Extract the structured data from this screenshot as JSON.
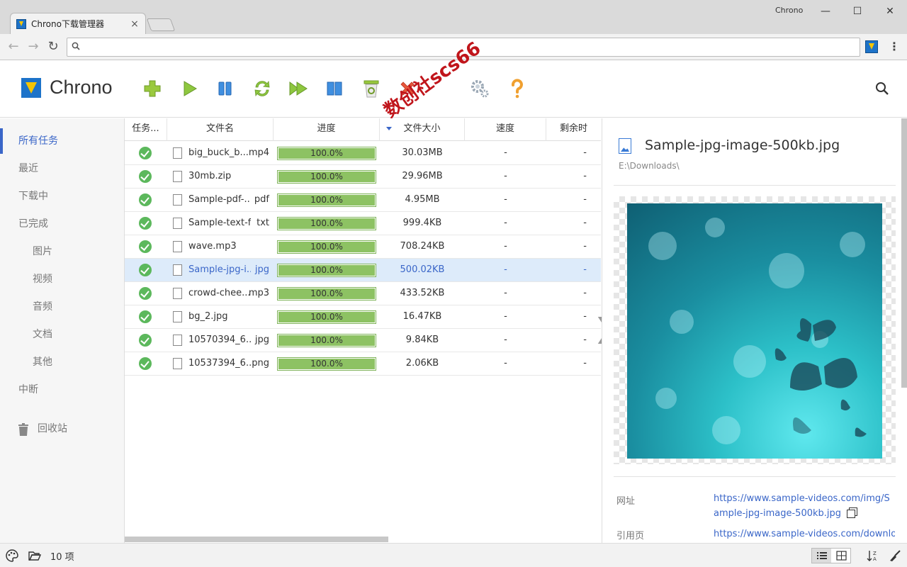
{
  "browser": {
    "tab_title": "Chrono下载管理器",
    "tab_close": "×",
    "user_name": "Chrono",
    "win_min": "—",
    "win_max": "☐",
    "win_close": "✕",
    "back": "←",
    "forward": "→",
    "reload": "↻",
    "menu": "⋮",
    "omnibox_value": ""
  },
  "app": {
    "name": "Chrono",
    "watermark": "数创社scs66"
  },
  "sidebar": {
    "items": [
      {
        "label": "所有任务"
      },
      {
        "label": "最近"
      },
      {
        "label": "下载中"
      },
      {
        "label": "已完成"
      },
      {
        "label": "图片"
      },
      {
        "label": "视频"
      },
      {
        "label": "音频"
      },
      {
        "label": "文档"
      },
      {
        "label": "其他"
      },
      {
        "label": "中断"
      },
      {
        "label": "回收站"
      }
    ]
  },
  "table": {
    "columns": {
      "task": "任务...",
      "filename": "文件名",
      "progress": "进度",
      "size": "文件大小",
      "speed": "速度",
      "remaining": "剩余时"
    },
    "rows": [
      {
        "name": "big_buck_b...",
        "ext": "mp4",
        "progress": 1.0,
        "progress_label": "100.0%",
        "size": "30.03MB",
        "speed": "-",
        "remaining": "-"
      },
      {
        "name": "30mb.zip",
        "ext": "",
        "progress": 1.0,
        "progress_label": "100.0%",
        "size": "29.96MB",
        "speed": "-",
        "remaining": "-"
      },
      {
        "name": "Sample-pdf-...",
        "ext": "pdf",
        "progress": 1.0,
        "progress_label": "100.0%",
        "size": "4.95MB",
        "speed": "-",
        "remaining": "-"
      },
      {
        "name": "Sample-text-fi...",
        "ext": "txt",
        "progress": 1.0,
        "progress_label": "100.0%",
        "size": "999.4KB",
        "speed": "-",
        "remaining": "-"
      },
      {
        "name": "wave.mp3",
        "ext": "",
        "progress": 1.0,
        "progress_label": "100.0%",
        "size": "708.24KB",
        "speed": "-",
        "remaining": "-"
      },
      {
        "name": "Sample-jpg-i...",
        "ext": "jpg",
        "progress": 1.0,
        "progress_label": "100.0%",
        "size": "500.02KB",
        "speed": "-",
        "remaining": "-"
      },
      {
        "name": "crowd-chee...",
        "ext": "mp3",
        "progress": 1.0,
        "progress_label": "100.0%",
        "size": "433.52KB",
        "speed": "-",
        "remaining": "-"
      },
      {
        "name": "bg_2.jpg",
        "ext": "",
        "progress": 1.0,
        "progress_label": "100.0%",
        "size": "16.47KB",
        "speed": "-",
        "remaining": "-"
      },
      {
        "name": "10570394_6...",
        "ext": "jpg",
        "progress": 1.0,
        "progress_label": "100.0%",
        "size": "9.84KB",
        "speed": "-",
        "remaining": "-"
      },
      {
        "name": "10537394_6...",
        "ext": "png",
        "progress": 1.0,
        "progress_label": "100.0%",
        "size": "2.06KB",
        "speed": "-",
        "remaining": "-"
      }
    ],
    "expander": "❯"
  },
  "detail": {
    "title": "Sample-jpg-image-500kb.jpg",
    "path": "E:\\Downloads\\",
    "url_label": "网址",
    "url_value": "https://www.sample-videos.com/img/Sample-jpg-image-500kb.jpg",
    "referrer_label": "引用页",
    "referrer_value": "https://www.sample-videos.com/downlo"
  },
  "footer": {
    "count": "10 项"
  },
  "colors": {
    "accent": "#3a66c8",
    "progress_fill": "#8dc263",
    "success": "#5cb85c",
    "selected_row": "#ddebfa"
  }
}
